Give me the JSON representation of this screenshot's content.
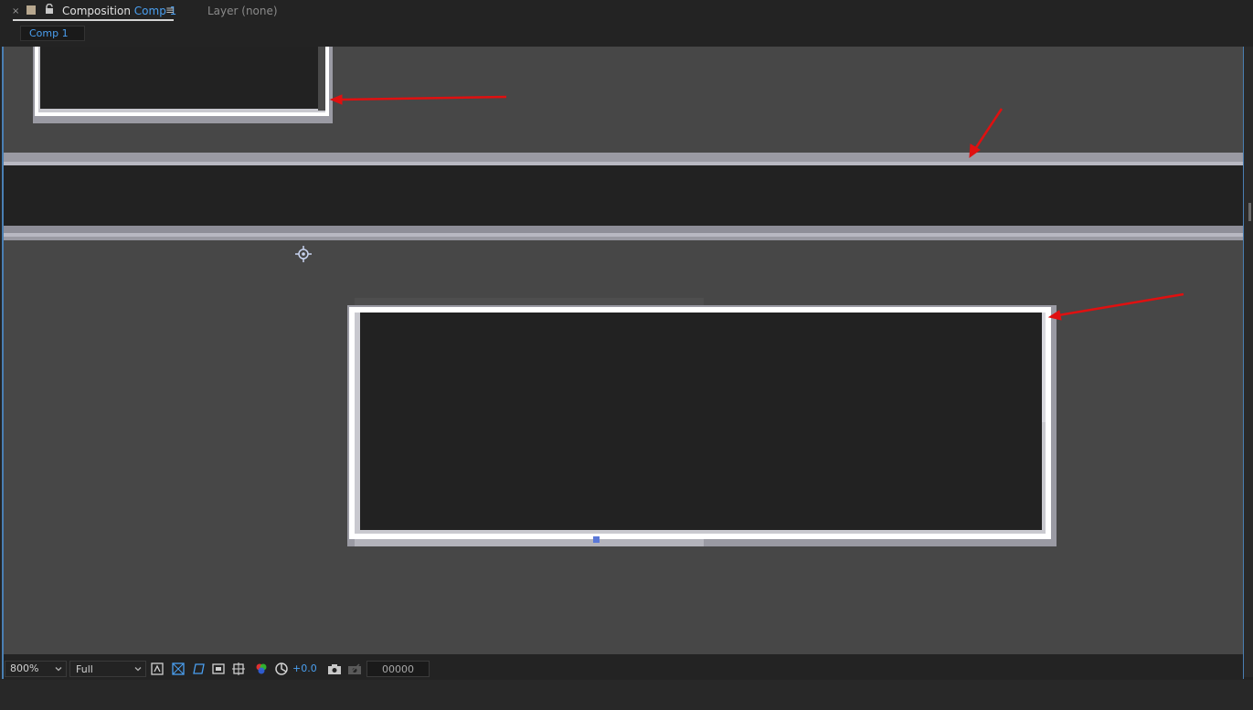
{
  "panel": {
    "close_glyph": "×",
    "tab_prefix": "Composition",
    "tab_comp_name": "Comp 1",
    "menu_glyph": "≡",
    "layer_tab": "Layer (none)",
    "breadcrumb": "Comp 1"
  },
  "toolbar": {
    "zoom": "800%",
    "resolution": "Full",
    "exposure": "+0.0",
    "timecode": "00000",
    "icons": [
      "always-preview-icon",
      "region-of-interest-icon",
      "transparency-grid-icon",
      "mask-visibility-icon",
      "guides-icon",
      "color-channel-icon",
      "reset-exposure-icon",
      "snapshot-icon",
      "show-snapshot-icon"
    ]
  },
  "colors": {
    "accent_blue": "#4a9ff0",
    "viewer_bg": "#474747",
    "annotation_red": "#e01010"
  }
}
